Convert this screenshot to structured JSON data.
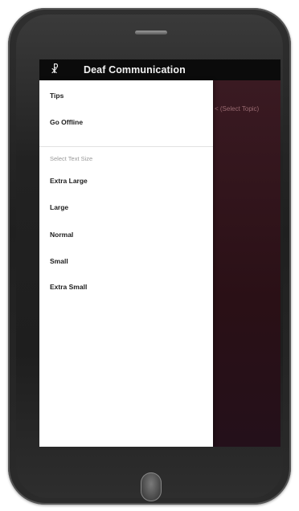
{
  "app": {
    "title": "Deaf Communication",
    "menu_icon": "app-logo-icon"
  },
  "backdrop": {
    "partial_text": "< (Select Topic)"
  },
  "drawer": {
    "items": [
      {
        "label": "Tips"
      },
      {
        "label": "Go Offline"
      }
    ],
    "text_size_header": "Select Text Size",
    "text_sizes": [
      {
        "label": "Extra Large"
      },
      {
        "label": "Large"
      },
      {
        "label": "Normal"
      },
      {
        "label": "Small"
      },
      {
        "label": "Extra Small"
      }
    ]
  },
  "colors": {
    "appbar": "#0b0b0b",
    "drawer": "#ffffff",
    "backdrop": "#2a1218",
    "phone_body": "#2a2a2a"
  }
}
